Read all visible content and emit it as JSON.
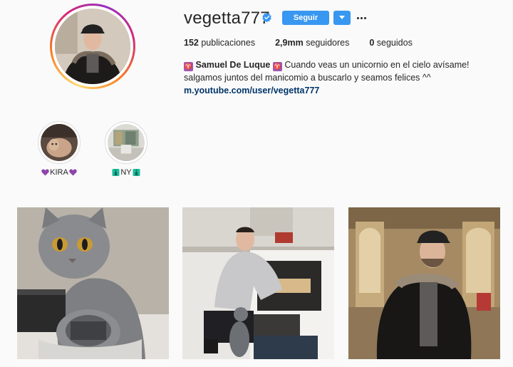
{
  "profile": {
    "username": "vegetta777",
    "verified": true,
    "follow_label": "Seguir",
    "dropdown_icon": "chevron-down-icon",
    "more_icon": "more-options-icon"
  },
  "stats": {
    "posts_value": "152",
    "posts_label": "publicaciones",
    "followers_value": "2,9mm",
    "followers_label": "seguidores",
    "following_value": "0",
    "following_label": "seguidos"
  },
  "bio": {
    "name": "Samuel De Luque",
    "text": "Cuando veas un unicornio en el cielo avísame! salgamos juntos del manicomio a buscarlo y seamos felices ^^",
    "link": "m.youtube.com/user/vegetta777"
  },
  "highlights": [
    {
      "label": "KIRA"
    },
    {
      "label": "NY"
    }
  ],
  "colors": {
    "accent": "#3897f0",
    "link": "#003569",
    "heart": "#8e44ad",
    "statue": "#1abc9c"
  }
}
